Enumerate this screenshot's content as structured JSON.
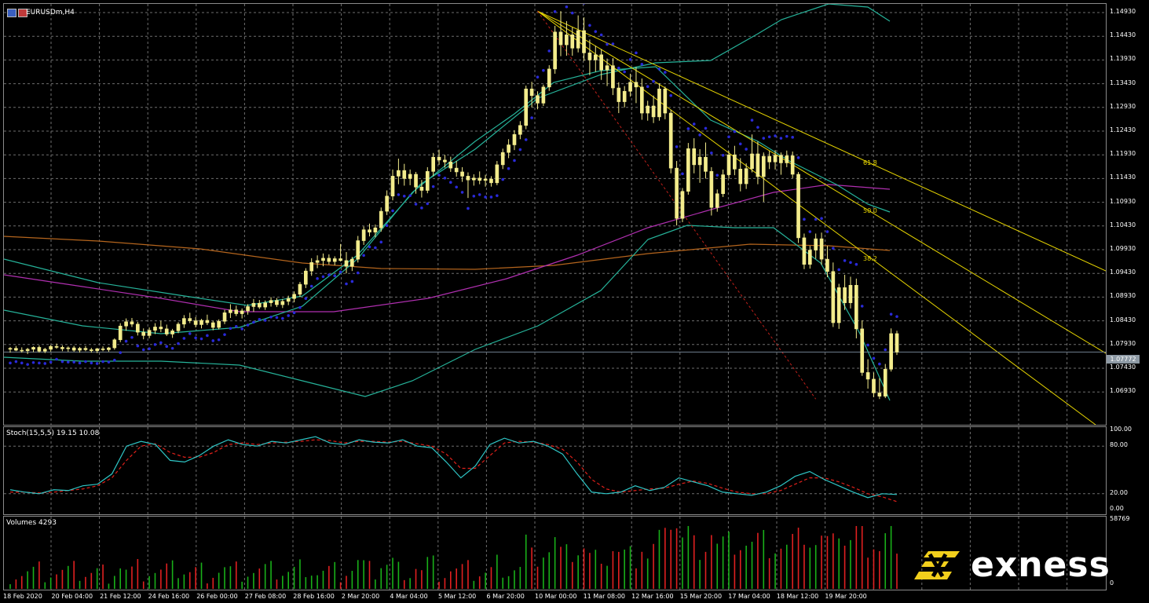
{
  "chart": {
    "symbol_label": "EURUSDm,H4",
    "current_price": "1.07772",
    "y_ticks": [
      "1.14930",
      "1.14430",
      "1.13930",
      "1.13430",
      "1.12930",
      "1.12430",
      "1.11930",
      "1.11430",
      "1.10930",
      "1.10430",
      "1.09930",
      "1.09430",
      "1.08930",
      "1.08430",
      "1.07930",
      "1.07430",
      "1.06930"
    ],
    "fib_labels": [
      "61.8",
      "50.0",
      "38.2"
    ]
  },
  "stochastic": {
    "label": "Stoch(15,5,5) 19.15 10.08",
    "y_ticks": [
      "100.00",
      "80.00",
      "20.00",
      "0.00"
    ]
  },
  "volumes": {
    "label": "Volumes 4293",
    "y_ticks": [
      "58769",
      "0"
    ]
  },
  "x_axis": {
    "labels": [
      "18 Feb 2020",
      "20 Feb 04:00",
      "21 Feb 12:00",
      "24 Feb 16:00",
      "26 Feb 00:00",
      "27 Feb 08:00",
      "28 Feb 16:00",
      "2 Mar 20:00",
      "4 Mar 04:00",
      "5 Mar 12:00",
      "6 Mar 20:00",
      "10 Mar 00:00",
      "11 Mar 08:00",
      "12 Mar 16:00",
      "15 Mar 20:00",
      "17 Mar 04:00",
      "18 Mar 12:00",
      "19 Mar 20:00"
    ]
  },
  "brand": {
    "name": "exness",
    "logo_icon": "exness-logo-icon"
  },
  "colors": {
    "bull": "#f3ec8c",
    "bear": "#f3ec8c",
    "grid": "#6e6e6e",
    "sar": "#2a2ad8",
    "bb": "#26b39a",
    "ma_magenta": "#b02fb0",
    "ma_orange": "#b5651d",
    "fib": "#e6d400",
    "stoch_main": "#2fc6c6",
    "stoch_signal": "#e0201a",
    "vol_up": "#19b019",
    "vol_down": "#e02020"
  },
  "chart_data": {
    "type": "candlestick",
    "series_label": "EURUSDm,H4",
    "y_range": [
      1.0668,
      1.151
    ],
    "candles": [
      [
        1.0783,
        1.0788,
        1.0776,
        1.0785
      ],
      [
        1.0785,
        1.079,
        1.0779,
        1.0781
      ],
      [
        1.0781,
        1.0787,
        1.0776,
        1.078
      ],
      [
        1.078,
        1.0786,
        1.0773,
        1.0783
      ],
      [
        1.0783,
        1.0789,
        1.0777,
        1.0787
      ],
      [
        1.0787,
        1.0791,
        1.0776,
        1.0779
      ],
      [
        1.0779,
        1.0786,
        1.0775,
        1.0783
      ],
      [
        1.0783,
        1.0792,
        1.0778,
        1.0789
      ],
      [
        1.0789,
        1.0795,
        1.0784,
        1.0787
      ],
      [
        1.0787,
        1.0791,
        1.0779,
        1.0784
      ],
      [
        1.0784,
        1.0789,
        1.0778,
        1.0786
      ],
      [
        1.0786,
        1.079,
        1.0778,
        1.0781
      ],
      [
        1.0781,
        1.0788,
        1.0776,
        1.0785
      ],
      [
        1.0785,
        1.079,
        1.0779,
        1.0782
      ],
      [
        1.0782,
        1.0786,
        1.0776,
        1.078
      ],
      [
        1.078,
        1.0786,
        1.0775,
        1.0784
      ],
      [
        1.0784,
        1.0789,
        1.0779,
        1.0782
      ],
      [
        1.0782,
        1.0788,
        1.0778,
        1.0786
      ],
      [
        1.0786,
        1.0806,
        1.0782,
        1.0803
      ],
      [
        1.0803,
        1.0838,
        1.0798,
        1.0832
      ],
      [
        1.0832,
        1.0848,
        1.0822,
        1.0841
      ],
      [
        1.0841,
        1.0849,
        1.083,
        1.0836
      ],
      [
        1.0836,
        1.0841,
        1.0812,
        1.0819
      ],
      [
        1.0819,
        1.0827,
        1.0804,
        1.0812
      ],
      [
        1.0812,
        1.0829,
        1.0806,
        1.0823
      ],
      [
        1.0823,
        1.0838,
        1.0815,
        1.083
      ],
      [
        1.083,
        1.0843,
        1.0819,
        1.0826
      ],
      [
        1.0826,
        1.0835,
        1.0811,
        1.0815
      ],
      [
        1.0815,
        1.0826,
        1.0807,
        1.0822
      ],
      [
        1.0822,
        1.084,
        1.0817,
        1.0836
      ],
      [
        1.0836,
        1.0855,
        1.0828,
        1.0848
      ],
      [
        1.0848,
        1.086,
        1.0838,
        1.0843
      ],
      [
        1.0843,
        1.0851,
        1.0829,
        1.0835
      ],
      [
        1.0835,
        1.0847,
        1.0827,
        1.0844
      ],
      [
        1.0844,
        1.0856,
        1.0834,
        1.0839
      ],
      [
        1.0839,
        1.0843,
        1.0823,
        1.0829
      ],
      [
        1.0829,
        1.0846,
        1.0825,
        1.0842
      ],
      [
        1.0842,
        1.0866,
        1.0836,
        1.086
      ],
      [
        1.086,
        1.0878,
        1.0849,
        1.0866
      ],
      [
        1.0866,
        1.0875,
        1.0853,
        1.0858
      ],
      [
        1.0858,
        1.0869,
        1.0848,
        1.0864
      ],
      [
        1.0864,
        1.0878,
        1.0856,
        1.0873
      ],
      [
        1.0873,
        1.0889,
        1.0862,
        1.088
      ],
      [
        1.088,
        1.0887,
        1.0868,
        1.0872
      ],
      [
        1.0872,
        1.0886,
        1.0866,
        1.0881
      ],
      [
        1.0881,
        1.0893,
        1.0873,
        1.0886
      ],
      [
        1.0886,
        1.0891,
        1.0872,
        1.0877
      ],
      [
        1.0877,
        1.0889,
        1.087,
        1.0884
      ],
      [
        1.0884,
        1.0896,
        1.0876,
        1.089
      ],
      [
        1.089,
        1.0905,
        1.0882,
        1.0899
      ],
      [
        1.0899,
        1.0925,
        1.0893,
        1.092
      ],
      [
        1.092,
        1.0954,
        1.0912,
        1.0948
      ],
      [
        1.0948,
        1.0975,
        1.0938,
        1.0966
      ],
      [
        1.0966,
        1.0981,
        1.0954,
        1.097
      ],
      [
        1.097,
        1.0985,
        1.0958,
        1.0975
      ],
      [
        1.0975,
        1.0983,
        1.0962,
        1.0968
      ],
      [
        1.0968,
        1.0979,
        1.096,
        1.0974
      ],
      [
        1.0974,
        1.1005,
        1.0968,
        1.097
      ],
      [
        1.097,
        1.0988,
        1.0943,
        1.0958
      ],
      [
        1.0958,
        1.0978,
        1.0948,
        1.0973
      ],
      [
        1.0973,
        1.1022,
        1.0966,
        1.1012
      ],
      [
        1.1012,
        1.1042,
        1.1003,
        1.1035
      ],
      [
        1.1035,
        1.1048,
        1.1021,
        1.103
      ],
      [
        1.103,
        1.1046,
        1.1019,
        1.1039
      ],
      [
        1.1039,
        1.1082,
        1.1031,
        1.1074
      ],
      [
        1.1074,
        1.1118,
        1.1066,
        1.1106
      ],
      [
        1.1106,
        1.1162,
        1.1097,
        1.1148
      ],
      [
        1.1148,
        1.1185,
        1.1131,
        1.116
      ],
      [
        1.116,
        1.1174,
        1.1128,
        1.1143
      ],
      [
        1.1143,
        1.1162,
        1.1129,
        1.1152
      ],
      [
        1.1152,
        1.1157,
        1.1111,
        1.1125
      ],
      [
        1.1125,
        1.114,
        1.1103,
        1.1118
      ],
      [
        1.1118,
        1.1167,
        1.1112,
        1.1158
      ],
      [
        1.1158,
        1.1197,
        1.1148,
        1.1188
      ],
      [
        1.1188,
        1.1204,
        1.1172,
        1.1182
      ],
      [
        1.1182,
        1.1193,
        1.1166,
        1.1178
      ],
      [
        1.1178,
        1.1189,
        1.1157,
        1.1165
      ],
      [
        1.1165,
        1.118,
        1.1147,
        1.1157
      ],
      [
        1.1157,
        1.1167,
        1.1136,
        1.1148
      ],
      [
        1.1148,
        1.1156,
        1.1102,
        1.114
      ],
      [
        1.114,
        1.1152,
        1.1128,
        1.1144
      ],
      [
        1.1144,
        1.1158,
        1.1131,
        1.1139
      ],
      [
        1.1139,
        1.1151,
        1.1126,
        1.1142
      ],
      [
        1.1142,
        1.1148,
        1.1126,
        1.1134
      ],
      [
        1.1134,
        1.118,
        1.1129,
        1.1172
      ],
      [
        1.1172,
        1.1206,
        1.1163,
        1.1198
      ],
      [
        1.1198,
        1.1226,
        1.1186,
        1.1214
      ],
      [
        1.1214,
        1.1245,
        1.1203,
        1.1236
      ],
      [
        1.1236,
        1.1264,
        1.1226,
        1.1255
      ],
      [
        1.1255,
        1.1339,
        1.1247,
        1.1332
      ],
      [
        1.1332,
        1.1347,
        1.1293,
        1.1318
      ],
      [
        1.1318,
        1.1327,
        1.1289,
        1.1302
      ],
      [
        1.1302,
        1.1341,
        1.1296,
        1.1336
      ],
      [
        1.1336,
        1.1382,
        1.1328,
        1.1374
      ],
      [
        1.1374,
        1.1465,
        1.1364,
        1.1452
      ],
      [
        1.1452,
        1.1496,
        1.1401,
        1.1425
      ],
      [
        1.1425,
        1.1475,
        1.1402,
        1.1446
      ],
      [
        1.1446,
        1.1462,
        1.1402,
        1.1418
      ],
      [
        1.1418,
        1.1487,
        1.1409,
        1.1455
      ],
      [
        1.1455,
        1.1483,
        1.1391,
        1.1408
      ],
      [
        1.1408,
        1.1436,
        1.1361,
        1.1393
      ],
      [
        1.1393,
        1.1423,
        1.1368,
        1.1404
      ],
      [
        1.1404,
        1.1416,
        1.1351,
        1.1372
      ],
      [
        1.1372,
        1.1396,
        1.1338,
        1.1381
      ],
      [
        1.1381,
        1.1397,
        1.1319,
        1.1334
      ],
      [
        1.1334,
        1.1346,
        1.1281,
        1.1305
      ],
      [
        1.1305,
        1.1338,
        1.1293,
        1.1327
      ],
      [
        1.1327,
        1.1364,
        1.1316,
        1.1346
      ],
      [
        1.1346,
        1.1378,
        1.1302,
        1.1336
      ],
      [
        1.1336,
        1.1354,
        1.1267,
        1.1281
      ],
      [
        1.1281,
        1.1307,
        1.1265,
        1.1296
      ],
      [
        1.1296,
        1.1318,
        1.126,
        1.1273
      ],
      [
        1.1273,
        1.1344,
        1.1265,
        1.1332
      ],
      [
        1.1332,
        1.1337,
        1.1268,
        1.1281
      ],
      [
        1.1281,
        1.1288,
        1.1154,
        1.1165
      ],
      [
        1.1165,
        1.118,
        1.1044,
        1.1059
      ],
      [
        1.1059,
        1.1123,
        1.1051,
        1.1116
      ],
      [
        1.1116,
        1.1218,
        1.1109,
        1.1206
      ],
      [
        1.1206,
        1.1228,
        1.1154,
        1.1172
      ],
      [
        1.1172,
        1.1205,
        1.1134,
        1.1188
      ],
      [
        1.1188,
        1.1219,
        1.1143,
        1.1158
      ],
      [
        1.1158,
        1.1167,
        1.1065,
        1.1082
      ],
      [
        1.1082,
        1.112,
        1.1073,
        1.1111
      ],
      [
        1.1111,
        1.1162,
        1.1104,
        1.1151
      ],
      [
        1.1151,
        1.1201,
        1.1143,
        1.1193
      ],
      [
        1.1193,
        1.1212,
        1.115,
        1.1163
      ],
      [
        1.1163,
        1.1186,
        1.1116,
        1.1132
      ],
      [
        1.1132,
        1.1175,
        1.1121,
        1.1164
      ],
      [
        1.1164,
        1.1236,
        1.1156,
        1.1195
      ],
      [
        1.1195,
        1.1221,
        1.1131,
        1.1147
      ],
      [
        1.1147,
        1.1198,
        1.1094,
        1.119
      ],
      [
        1.119,
        1.1201,
        1.1163,
        1.1178
      ],
      [
        1.1178,
        1.1203,
        1.1162,
        1.1192
      ],
      [
        1.1192,
        1.1198,
        1.1151,
        1.1176
      ],
      [
        1.1176,
        1.1202,
        1.1167,
        1.1191
      ],
      [
        1.1191,
        1.12,
        1.1144,
        1.1152
      ],
      [
        1.1152,
        1.1157,
        1.1007,
        1.1018
      ],
      [
        1.1018,
        1.1027,
        1.0952,
        1.0962
      ],
      [
        1.0962,
        1.1001,
        1.0953,
        1.0992
      ],
      [
        1.0992,
        1.1027,
        1.0974,
        1.1016
      ],
      [
        1.1016,
        1.1029,
        1.0961,
        1.0973
      ],
      [
        1.0973,
        1.1001,
        1.0935,
        1.0947
      ],
      [
        1.0947,
        1.0966,
        1.083,
        1.0839
      ],
      [
        1.0839,
        1.0921,
        1.0826,
        1.0913
      ],
      [
        1.0913,
        1.094,
        1.0866,
        1.0881
      ],
      [
        1.0881,
        1.0936,
        1.0869,
        1.0918
      ],
      [
        1.0918,
        1.0932,
        1.0806,
        1.0826
      ],
      [
        1.0826,
        1.0844,
        1.0727,
        1.0734
      ],
      [
        1.0734,
        1.0762,
        1.07,
        1.072
      ],
      [
        1.072,
        1.0734,
        1.0682,
        1.0691
      ],
      [
        1.0691,
        1.0722,
        1.0678,
        1.0684
      ],
      [
        1.0684,
        1.0752,
        1.068,
        1.0741
      ],
      [
        1.0741,
        1.0827,
        1.0736,
        1.0816
      ],
      [
        1.0816,
        1.0822,
        1.0771,
        1.0777
      ]
    ],
    "stochastic": {
      "main_last": 19.15,
      "signal_last": 10.08,
      "y_range": [
        0,
        100
      ],
      "levels": [
        20,
        80
      ]
    },
    "volume": {
      "last": 4293,
      "y_range": [
        0,
        58769
      ]
    },
    "indicators": [
      "Parabolic SAR",
      "Bollinger Bands",
      "Moving Average (magenta)",
      "Moving Average (orange)",
      "Fibonacci fan (38.2, 50.0, 61.8)"
    ]
  }
}
